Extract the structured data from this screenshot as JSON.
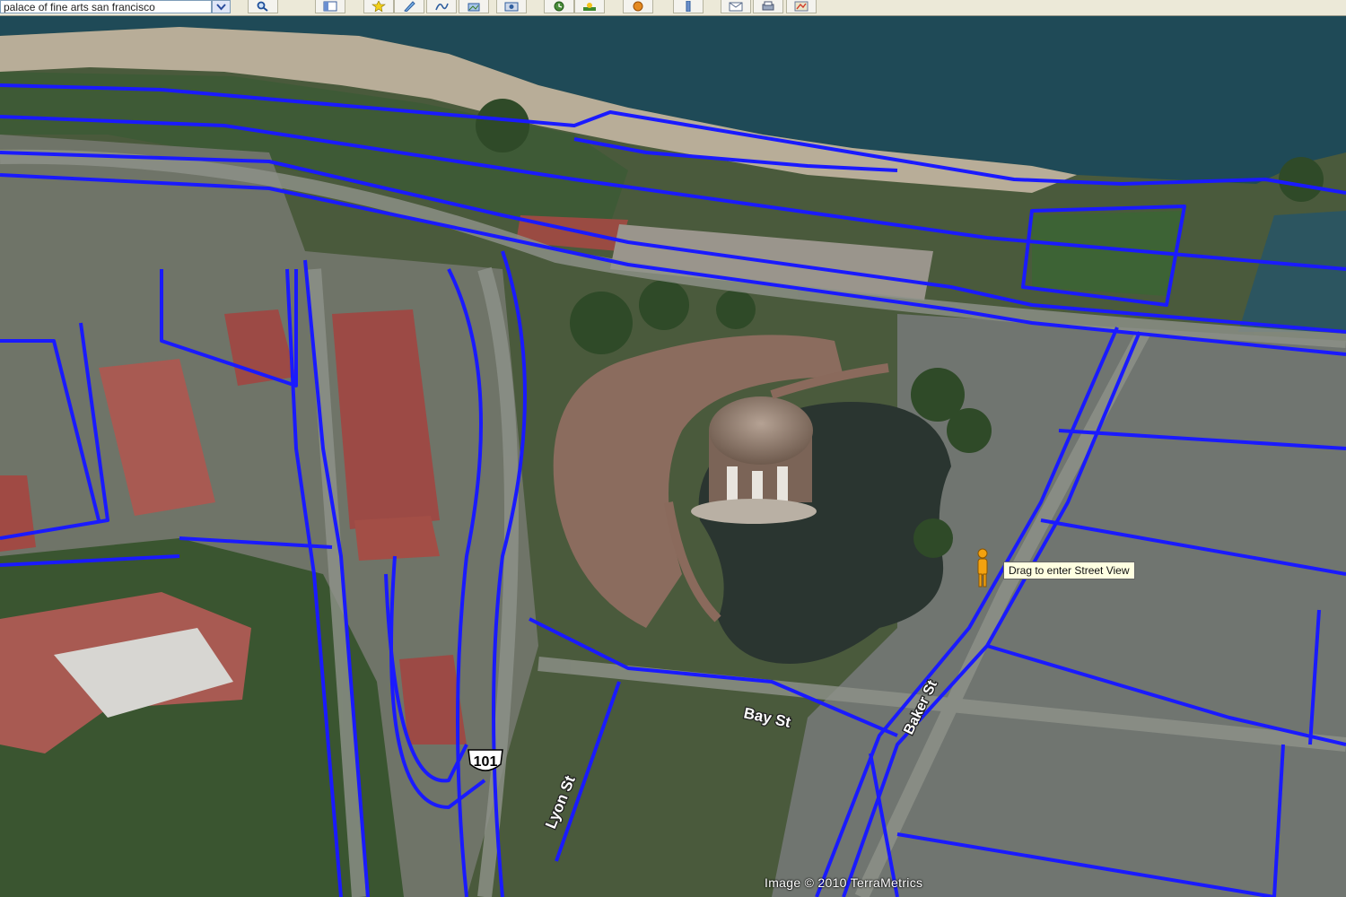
{
  "toolbar": {
    "search_value": "palace of fine arts san francisco",
    "buttons": [
      {
        "name": "search-icon",
        "label": "search"
      },
      {
        "name": "sidebar-icon",
        "label": "sidebar"
      },
      {
        "name": "placemark-icon",
        "label": "placemark"
      },
      {
        "name": "polygon-icon",
        "label": "polygon"
      },
      {
        "name": "path-icon",
        "label": "path"
      },
      {
        "name": "overlay-icon",
        "label": "overlay"
      },
      {
        "name": "tour-icon",
        "label": "tour"
      },
      {
        "name": "historical-imagery-icon",
        "label": "historical"
      },
      {
        "name": "sunlight-icon",
        "label": "sunlight"
      },
      {
        "name": "planet-icon",
        "label": "planet"
      },
      {
        "name": "ruler-icon",
        "label": "ruler"
      },
      {
        "name": "email-icon",
        "label": "email"
      },
      {
        "name": "print-icon",
        "label": "print"
      },
      {
        "name": "maps-icon",
        "label": "maps"
      }
    ]
  },
  "map": {
    "streets": {
      "bay_st": "Bay St",
      "baker_st": "Baker St",
      "lyon_st": "Lyon St",
      "highway_shield": "101"
    },
    "tooltip": "Drag to enter Street View",
    "credit": "Image © 2010 TerraMetrics",
    "road_color": "#1a1aff",
    "water_color": "#1f4a57",
    "beach_color": "#b8ad98"
  }
}
